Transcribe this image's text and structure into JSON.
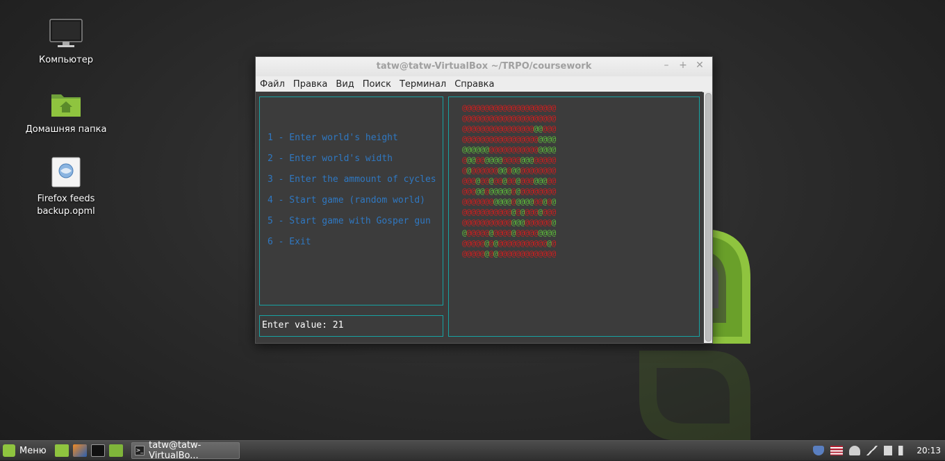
{
  "desktop": {
    "icons": [
      {
        "label": "Компьютер",
        "icon": "computer-icon"
      },
      {
        "label": "Домашняя папка",
        "icon": "home-folder-icon"
      },
      {
        "label_line1": "Firefox feeds",
        "label_line2": "backup.opml",
        "icon": "opml-file-icon"
      }
    ]
  },
  "window": {
    "title": "tatw@tatw-VirtualBox ~/TRPO/coursework",
    "controls": {
      "minimize": "–",
      "maximize": "+",
      "close": "✕"
    },
    "menu": [
      "Файл",
      "Правка",
      "Вид",
      "Поиск",
      "Терминал",
      "Справка"
    ]
  },
  "terminal": {
    "options": [
      "1 - Enter world's height",
      "2 - Enter world's width",
      "3 - Enter the ammount of cycles",
      "4 - Start game (random world)",
      "5 - Start game with Gosper gun",
      "6 - Exit"
    ],
    "input_prompt": "Enter value: 21",
    "world_rows": [
      "rrrrrrrrrrrrrrrrrrrrr",
      "rrrrrrrrrrrrrrrrrrrrr",
      "rrrrrrrrrrrrrrrrggrrr",
      "rrrrrrrrrrrrrrrrrgggg",
      "ggggggrrrrrrrrrrrgggg",
      "rggrrggggrrrrgggrrrrr",
      "rgrrrrrrggrggrrrrrrrr",
      "rrrgrrgrrgrrgrrrgggrr",
      "rrrggrgggggrgrrrrrrrr",
      "rrrrrrrggggrggggrrgrg",
      "rrrrrrrrrrrgrgrrrgrrr",
      "rrrrrrrrrrrgggrrrrrrg",
      "grrrrrgrrrrgrrrrrgggg",
      "rrrrrgrgrrrrrrrrrrrgr",
      "rrrrrgrgrrrrrrrrrrrrr"
    ],
    "cell_char": "@",
    "colors": {
      "alive": "#5dbb3a",
      "dead": "#cc1f1f",
      "menu_text": "#2f78c2",
      "border": "#17a3a3"
    }
  },
  "taskbar": {
    "menu_label": "Меню",
    "task_label": "tatw@tatw-VirtualBo...",
    "clock": "20:13"
  }
}
